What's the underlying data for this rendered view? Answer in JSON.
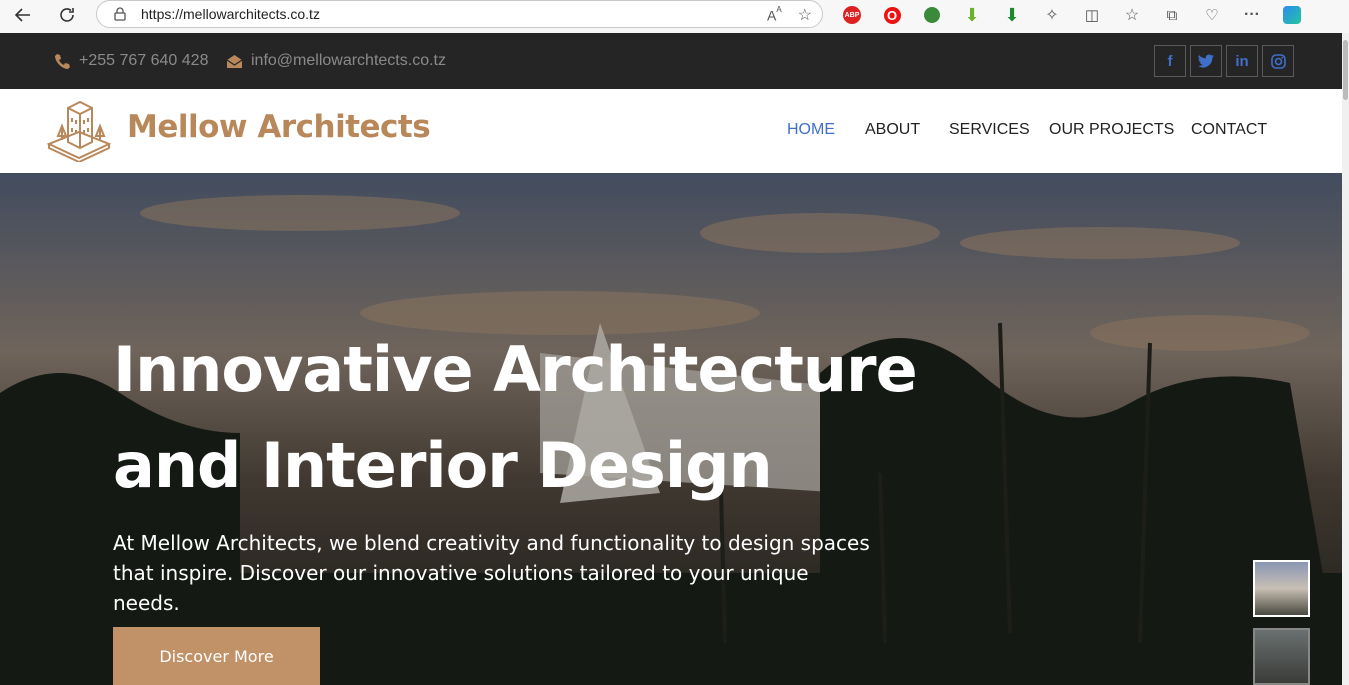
{
  "browser": {
    "url": "https://mellowarchitects.co.tz"
  },
  "topbar": {
    "phone": "+255 767 640 428",
    "email": "info@mellowarchtects.co.tz",
    "social": [
      "f",
      "🐦",
      "in",
      "◎"
    ]
  },
  "brand": {
    "name": "Mellow Architects",
    "color": "#b8875a"
  },
  "nav": {
    "items": [
      "HOME",
      "ABOUT",
      "SERVICES",
      "OUR PROJECTS",
      "CONTACT"
    ],
    "active_color": "#3f6fc8"
  },
  "hero": {
    "title_line1": "Innovative Architecture",
    "title_line2": "and Interior Design",
    "subtitle": "At Mellow Architects, we blend creativity and functionality to design spaces that inspire. Discover our innovative solutions tailored to your unique needs.",
    "cta_label": "Discover More",
    "cta_color": "#c19167"
  }
}
